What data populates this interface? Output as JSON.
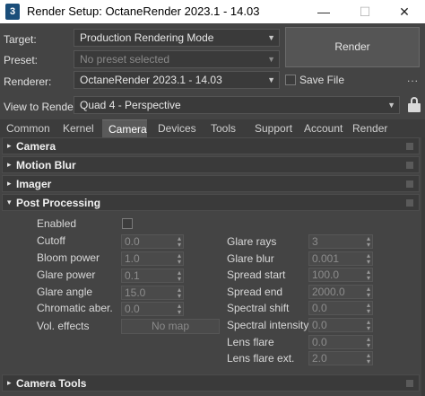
{
  "window": {
    "icon_label": "3",
    "title": "Render Setup: OctaneRender 2023.1 - 14.03",
    "minimize": "—",
    "maximize": "☐",
    "close": "✕"
  },
  "setup": {
    "target_label": "Target:",
    "target_value": "Production Rendering Mode",
    "preset_label": "Preset:",
    "preset_placeholder": "No preset selected",
    "renderer_label": "Renderer:",
    "renderer_value": "OctaneRender 2023.1 - 14.03",
    "view_label": "View to Render:",
    "view_value": "Quad 4 - Perspective",
    "render_button": "Render",
    "save_file_label": "Save File",
    "save_file_checked": false,
    "more_button": "..."
  },
  "tabs": [
    {
      "label": "Common",
      "active": false
    },
    {
      "label": "Kernel",
      "active": false
    },
    {
      "label": "Camera",
      "active": true
    },
    {
      "label": "Devices",
      "active": false
    },
    {
      "label": "Tools",
      "active": false
    },
    {
      "label": "Support",
      "active": false
    },
    {
      "label": "Account",
      "active": false
    },
    {
      "label": "Render Elements",
      "active": false
    }
  ],
  "rollouts": {
    "camera": {
      "title": "Camera",
      "expanded": false,
      "marker": "▸"
    },
    "motion_blur": {
      "title": "Motion Blur",
      "expanded": false,
      "marker": "▸"
    },
    "imager": {
      "title": "Imager",
      "expanded": false,
      "marker": "▸"
    },
    "post_processing": {
      "title": "Post Processing",
      "expanded": true,
      "marker": "▾"
    },
    "camera_tools": {
      "title": "Camera Tools",
      "expanded": false,
      "marker": "▸"
    }
  },
  "post_processing": {
    "enabled_label": "Enabled",
    "enabled_checked": false,
    "left_fields": [
      {
        "label": "Cutoff",
        "value": "0.0"
      },
      {
        "label": "Bloom power",
        "value": "1.0"
      },
      {
        "label": "Glare power",
        "value": "0.1"
      },
      {
        "label": "Glare angle",
        "value": "15.0"
      },
      {
        "label": "Chromatic aber.",
        "value": "0.0"
      }
    ],
    "vol_effects_label": "Vol. effects",
    "vol_effects_button": "No map",
    "right_fields": [
      {
        "label": "Glare rays",
        "value": "3"
      },
      {
        "label": "Glare blur",
        "value": "0.001"
      },
      {
        "label": "Spread start",
        "value": "100.0"
      },
      {
        "label": "Spread end",
        "value": "2000.0"
      },
      {
        "label": "Spectral shift",
        "value": "0.0"
      },
      {
        "label": "Spectral intensity",
        "value": "0.0"
      },
      {
        "label": "Lens flare",
        "value": "0.0"
      },
      {
        "label": "Lens flare ext.",
        "value": "2.0"
      }
    ]
  },
  "colors": {
    "panel_bg": "#444444",
    "field_bg": "#3a3a3a",
    "active_tab": "#5a5a5a",
    "title_bar": "#ffffff"
  }
}
